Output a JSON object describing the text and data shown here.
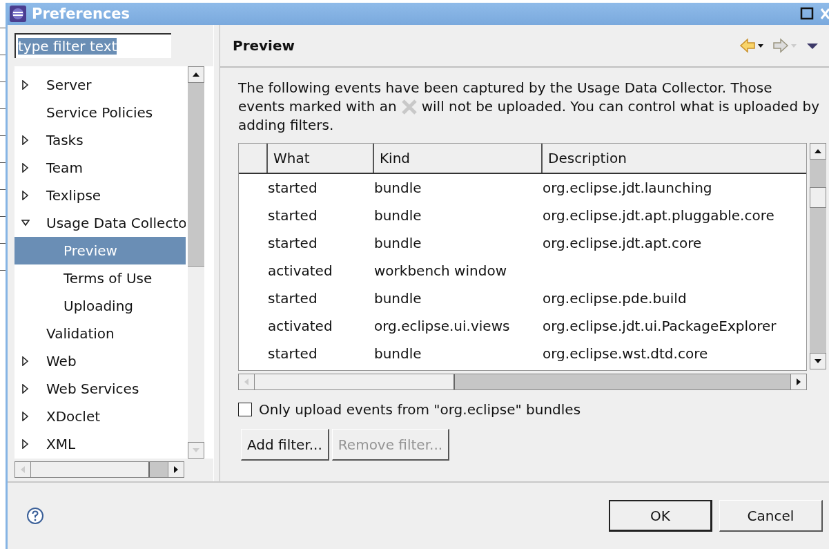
{
  "window": {
    "title": "Preferences"
  },
  "filter": {
    "value": "type filter text"
  },
  "tree": [
    {
      "label": "Server",
      "kind": "folder",
      "expanded": false,
      "selected": false
    },
    {
      "label": "Service Policies",
      "kind": "leaf",
      "selected": false
    },
    {
      "label": "Tasks",
      "kind": "folder",
      "expanded": false,
      "selected": false
    },
    {
      "label": "Team",
      "kind": "folder",
      "expanded": false,
      "selected": false
    },
    {
      "label": "Texlipse",
      "kind": "folder",
      "expanded": false,
      "selected": false
    },
    {
      "label": "Usage Data Collecto",
      "kind": "folder",
      "expanded": true,
      "selected": false,
      "children": [
        {
          "label": "Preview",
          "selected": true
        },
        {
          "label": "Terms of Use",
          "selected": false
        },
        {
          "label": "Uploading",
          "selected": false
        }
      ]
    },
    {
      "label": "Validation",
      "kind": "leaf",
      "selected": false
    },
    {
      "label": "Web",
      "kind": "folder",
      "expanded": false,
      "selected": false
    },
    {
      "label": "Web Services",
      "kind": "folder",
      "expanded": false,
      "selected": false
    },
    {
      "label": "XDoclet",
      "kind": "folder",
      "expanded": false,
      "selected": false
    },
    {
      "label": "XML",
      "kind": "folder",
      "expanded": false,
      "selected": false
    }
  ],
  "page": {
    "title": "Preview",
    "description": [
      {
        "kind": "text",
        "text": "The following events have been captured by the Usage Data Collector. Those"
      },
      {
        "kind": "marked",
        "before": "events marked with an",
        "after": "will not be uploaded. You can control what is uploaded by"
      },
      {
        "kind": "text",
        "text": "adding filters."
      }
    ]
  },
  "table": {
    "columns": [
      "What",
      "Kind",
      "Description"
    ],
    "rows": [
      {
        "what": "started",
        "kind": "bundle",
        "description": "org.eclipse.jdt.launching"
      },
      {
        "what": "started",
        "kind": "bundle",
        "description": "org.eclipse.jdt.apt.pluggable.core"
      },
      {
        "what": "started",
        "kind": "bundle",
        "description": "org.eclipse.jdt.apt.core"
      },
      {
        "what": "activated",
        "kind": "workbench window"
      },
      {
        "what": "started",
        "kind": "bundle",
        "description": "org.eclipse.pde.build"
      },
      {
        "what": "activated",
        "kind": "org.eclipse.ui.views",
        "description": "org.eclipse.jdt.ui.PackageExplorer"
      },
      {
        "what": "started",
        "kind": "bundle",
        "description": "org.eclipse.wst.dtd.core"
      }
    ]
  },
  "only_eclipse": {
    "label": "Only upload events from \"org.eclipse\" bundles",
    "checked": false
  },
  "filter_buttons": [
    {
      "label": "Add filter...",
      "disabled": false
    },
    {
      "label": "Remove filter...",
      "disabled": true
    }
  ],
  "dialog_buttons": [
    {
      "label": "OK",
      "default": true
    },
    {
      "label": "Cancel",
      "default": false
    }
  ]
}
